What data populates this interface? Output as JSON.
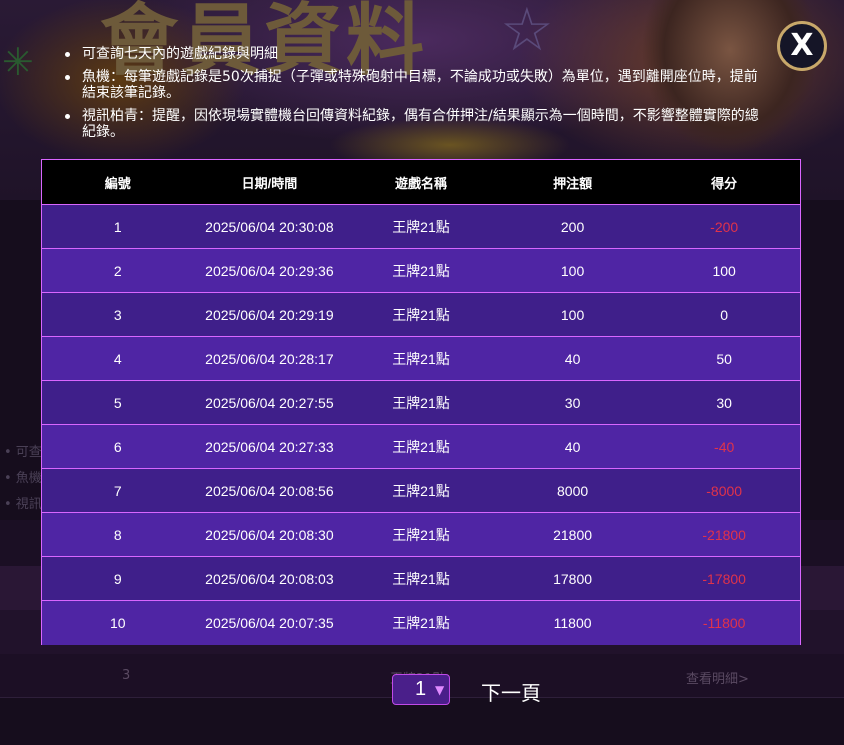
{
  "background": {
    "banner_title": "會員資料",
    "notes": [
      "• 可查",
      "• 魚機",
      "• 視訊"
    ],
    "table_row3": {
      "id": "3",
      "game": "王牌21點",
      "link": "查看明細>"
    }
  },
  "notes": [
    "可查詢七天內的遊戲紀錄與明細",
    "魚機：每筆遊戲記錄是50次捕捉（子彈或特殊砲射中目標，不論成功或失敗）為單位，遇到離開座位時，提前結束該筆記錄。",
    "視訊柏青：提醒，因依現場實體機台回傳資料紀錄，偶有合併押注/結果顯示為一個時間，不影響整體實際的總紀錄。"
  ],
  "close": {
    "label": "X"
  },
  "table": {
    "headers": [
      "編號",
      "日期/時間",
      "遊戲名稱",
      "押注額",
      "得分"
    ],
    "rows": [
      {
        "id": "1",
        "datetime": "2025/06/04 20:30:08",
        "game": "王牌21點",
        "bet": "200",
        "score": "-200"
      },
      {
        "id": "2",
        "datetime": "2025/06/04 20:29:36",
        "game": "王牌21點",
        "bet": "100",
        "score": "100"
      },
      {
        "id": "3",
        "datetime": "2025/06/04 20:29:19",
        "game": "王牌21點",
        "bet": "100",
        "score": "0"
      },
      {
        "id": "4",
        "datetime": "2025/06/04 20:28:17",
        "game": "王牌21點",
        "bet": "40",
        "score": "50"
      },
      {
        "id": "5",
        "datetime": "2025/06/04 20:27:55",
        "game": "王牌21點",
        "bet": "30",
        "score": "30"
      },
      {
        "id": "6",
        "datetime": "2025/06/04 20:27:33",
        "game": "王牌21點",
        "bet": "40",
        "score": "-40"
      },
      {
        "id": "7",
        "datetime": "2025/06/04 20:08:56",
        "game": "王牌21點",
        "bet": "8000",
        "score": "-8000"
      },
      {
        "id": "8",
        "datetime": "2025/06/04 20:08:30",
        "game": "王牌21點",
        "bet": "21800",
        "score": "-21800"
      },
      {
        "id": "9",
        "datetime": "2025/06/04 20:08:03",
        "game": "王牌21點",
        "bet": "17800",
        "score": "-17800"
      },
      {
        "id": "10",
        "datetime": "2025/06/04 20:07:35",
        "game": "王牌21點",
        "bet": "11800",
        "score": "-11800"
      }
    ],
    "colors": {
      "negative": "#e0334a",
      "border": "#d966ff",
      "header_bg": "#000000"
    }
  },
  "pagination": {
    "current_page": "1",
    "caret": "▼",
    "next_label": "下一頁"
  }
}
